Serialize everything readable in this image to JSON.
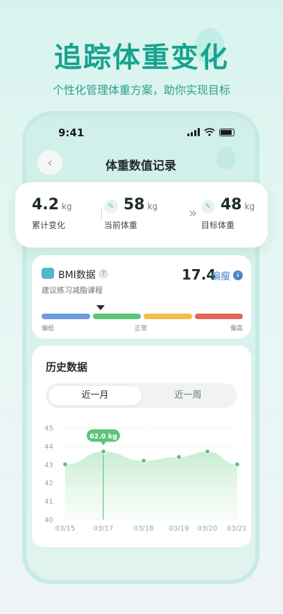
{
  "hero": {
    "title": "追踪体重变化",
    "subtitle": "个性化管理体重方案，助你实现目标"
  },
  "status_bar": {
    "time": "9:41"
  },
  "nav": {
    "title": "体重数值记录",
    "back_icon": "chevron-left-icon"
  },
  "summary": {
    "total_change": {
      "value": "4.2",
      "unit": "kg",
      "label": "累计变化"
    },
    "current": {
      "value": "58",
      "unit": "kg",
      "label": "当前体重"
    },
    "target": {
      "value": "48",
      "unit": "kg",
      "label": "目标体重"
    },
    "arrow": "»"
  },
  "bmi": {
    "title": "BMI数据",
    "help": "?",
    "value": "17.4",
    "status": "偏瘦",
    "tip": "建议练习减脂课程",
    "labels": [
      "偏低",
      "正常",
      "偏高"
    ],
    "colors": [
      "#6b9be0",
      "#5cc578",
      "#f2be4c",
      "#e0665a"
    ]
  },
  "history": {
    "title": "历史数据",
    "tabs": [
      "近一月",
      "近一周"
    ],
    "active_tab": 0
  },
  "chart_data": {
    "type": "area",
    "x": [
      "03/15",
      "03/17",
      "03/18",
      "03/19",
      "03/20",
      "03/21"
    ],
    "series": [
      {
        "values": [
          43.0,
          43.7,
          43.2,
          43.4,
          43.7,
          43.0
        ]
      }
    ],
    "ylim": [
      40,
      45
    ],
    "yticks": [
      40,
      41,
      42,
      43,
      44,
      45
    ],
    "highlight": {
      "x": "03/17",
      "label": "62.0 kg"
    },
    "color": "#5cc578",
    "grid": true
  }
}
